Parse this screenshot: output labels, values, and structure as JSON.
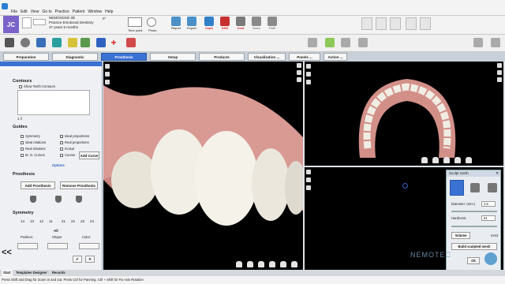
{
  "menu": [
    "File",
    "Edit",
    "View",
    "Go to",
    "Practice",
    "Patient",
    "Window",
    "Help"
  ],
  "patient": {
    "initials": "JC",
    "software": "NEMOSDSD 3D",
    "practice": "Practice Emotional Dentistry",
    "age": "37 years 5 months",
    "angle": "0°"
  },
  "thumbs": {
    "first": "Time point",
    "second": "Photo"
  },
  "toolbar_buttons": [
    "Report",
    "Export",
    "Ceph",
    "DSD",
    "Cost",
    "Scan",
    "FAB"
  ],
  "toolbar_sublabels": [
    "",
    "",
    "Analysis",
    "Smile",
    "3D",
    "Viewer",
    "Guide"
  ],
  "tabs": [
    "Preparation",
    "Diagnostic",
    "Prosthesis",
    "Setup",
    "Products",
    "Visualization ...",
    "Panels ...",
    "Action ..."
  ],
  "active_tab": "Prosthesis",
  "left": {
    "contours_title": "Contours",
    "show_contours": "Show Teeth Contours",
    "count": "1 Å",
    "guides_title": "Guides",
    "guides_left": [
      "Symmetry",
      "Ideal relations",
      "Real relations",
      "M. G. Curves"
    ],
    "guides_right": [
      "Ideal proportions",
      "Real proportions",
      "Incisal",
      "Curves"
    ],
    "add_curve": "Add Curve",
    "options": "Options",
    "prosthesis_title": "Prosthesis",
    "add_prosthesis": "Add Prosthesis",
    "remove_prosthesis": "Remove Prosthesis",
    "symmetry_title": "Symmetry",
    "teeth_numbers": [
      "14",
      "13",
      "12",
      "11",
      "21",
      "22",
      "23",
      "24"
    ],
    "all": "All",
    "position": "Position:",
    "shape": "Shape:",
    "color": "Color:",
    "collapse": "<<"
  },
  "sculpt": {
    "title": "Sculpt mesh",
    "diameter_label": "Diameter: (mm.)",
    "diameter_value": "3,5",
    "hardness_label": "Hardness:",
    "hardness_value": "81",
    "volume_label": "Volume",
    "volume_unit": "mm3",
    "build": "Build sculpted mesh",
    "ok": "Ok"
  },
  "brand": "NEMOTEC",
  "bottom_tabs": [
    "Start",
    "Templates Designer",
    "Records"
  ],
  "status": "Press Shift and Drag for Zoom in and out. Press Ctrl for Panning. Ctrl + Shift for Fix Axis Rotation",
  "colors": {
    "accent": "#3a72d4",
    "gum": "#d99a94",
    "tooth": "#f2efe6",
    "viewport": "#000000"
  }
}
